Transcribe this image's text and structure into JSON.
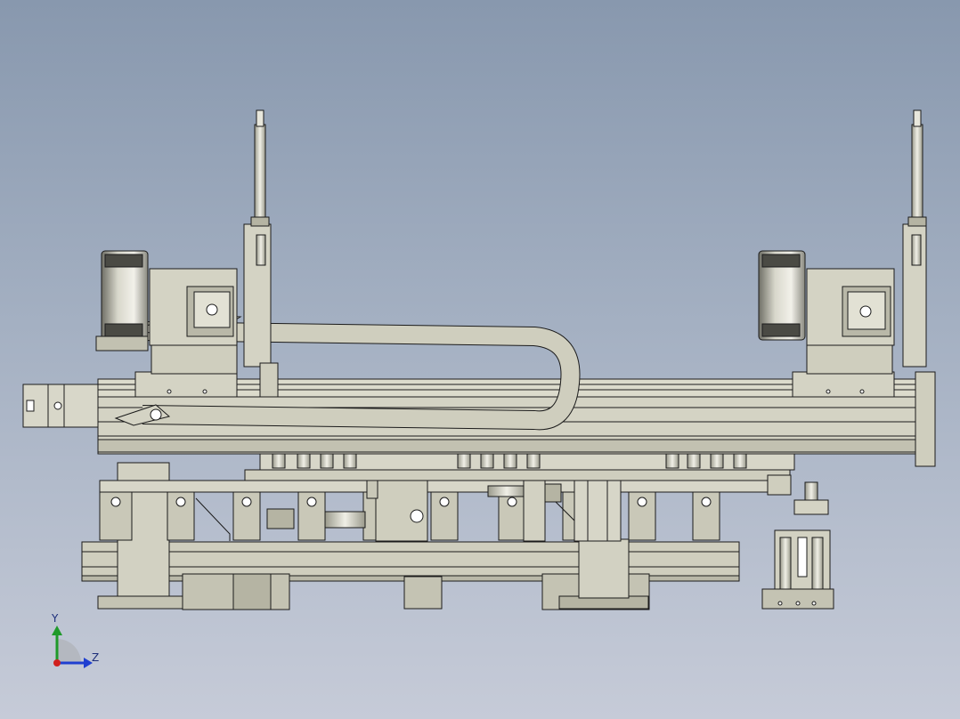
{
  "triad": {
    "y_label": "Y",
    "z_label": "Z",
    "y_color": "#1f9a2a",
    "z_color": "#1f3fd0",
    "x_color": "#d0201e"
  },
  "model": {
    "body_fill": "#c9c8b8",
    "body_fill_dark": "#b5b4a3",
    "body_fill_light": "#dcdbcc",
    "line_color": "#1b1b1b",
    "background_top": "#8898ae",
    "background_bottom": "#c6cbd8"
  }
}
